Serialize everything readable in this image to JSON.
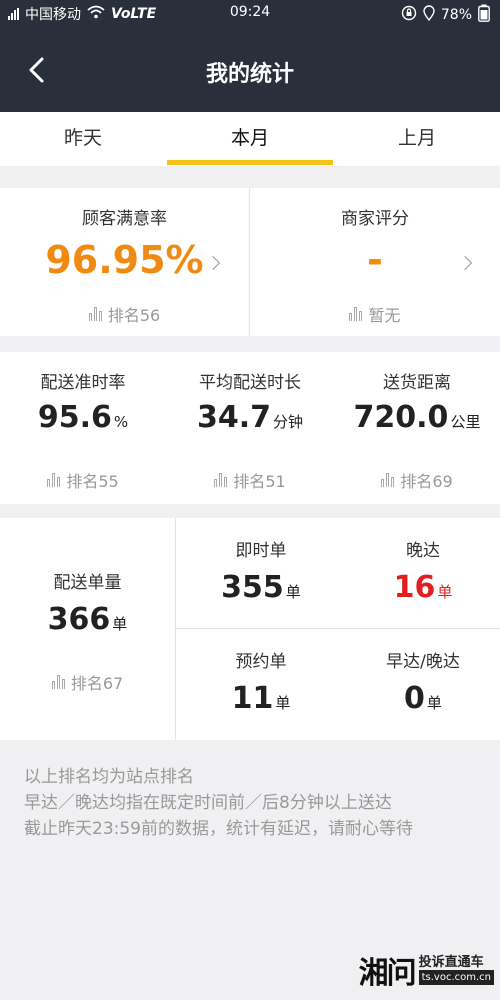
{
  "status_bar": {
    "carrier": "中国移动",
    "network": "VoLTE",
    "time": "09:24",
    "battery": "78%"
  },
  "header": {
    "title": "我的统计",
    "back_icon": "chevron-left-icon"
  },
  "tabs": [
    {
      "label": "昨天"
    },
    {
      "label": "本月",
      "active": true
    },
    {
      "label": "上月"
    }
  ],
  "accent_color": "#f2c316",
  "satisfaction": {
    "label": "顾客满意率",
    "value": "96.95%",
    "color": "#f08a12",
    "rank": "排名56"
  },
  "merchant_rating": {
    "label": "商家评分",
    "value": "-",
    "color": "#f08a12",
    "rank": "暂无"
  },
  "metrics": [
    {
      "label": "配送准时率",
      "value": "95.6",
      "unit": "%",
      "rank": "排名55"
    },
    {
      "label": "平均配送时长",
      "value": "34.7",
      "unit": "分钟",
      "rank": "排名51"
    },
    {
      "label": "送货距离",
      "value": "720.0",
      "unit": "公里",
      "rank": "排名69"
    }
  ],
  "orders": {
    "label": "配送单量",
    "value": "366",
    "unit": "单",
    "rank": "排名67",
    "instant": {
      "label": "即时单",
      "value": "355",
      "unit": "单"
    },
    "late": {
      "label": "晚达",
      "value": "16",
      "unit": "单",
      "color": "#e02020"
    },
    "reserved": {
      "label": "预约单",
      "value": "11",
      "unit": "单"
    },
    "early_late": {
      "label": "早达/晚达",
      "value": "0",
      "unit": "单"
    }
  },
  "notes": [
    "以上排名均为站点排名",
    "早达／晚达均指在既定时间前／后8分钟以上送达",
    "截止昨天23:59前的数据，统计有延迟，请耐心等待"
  ],
  "watermark": {
    "logo": "湘问",
    "text": "投诉直通车",
    "url": "ts.voc.com.cn"
  }
}
